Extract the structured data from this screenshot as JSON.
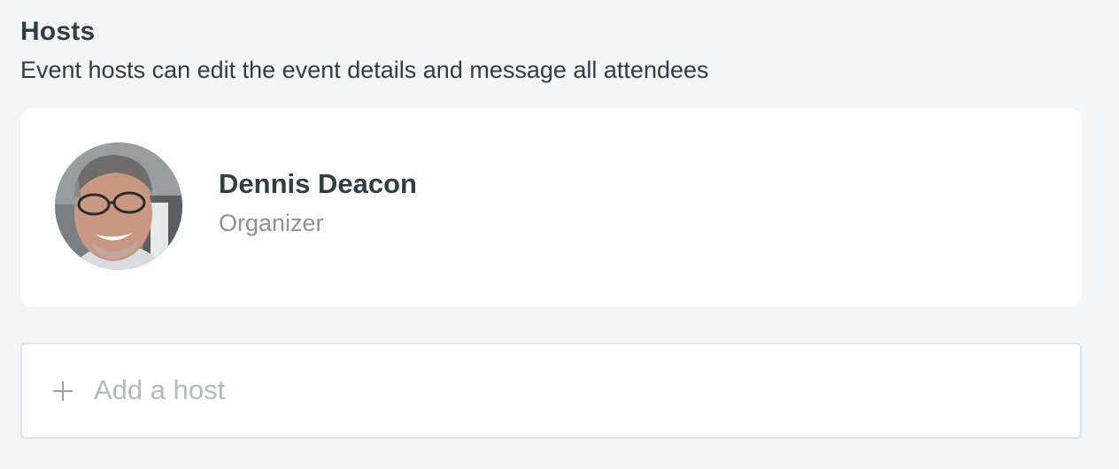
{
  "section": {
    "title": "Hosts",
    "description": "Event hosts can edit the event details and message all attendees"
  },
  "hosts": [
    {
      "name": "Dennis Deacon",
      "role": "Organizer",
      "avatar": "avatar-photo"
    }
  ],
  "add_host": {
    "label": "Add a host",
    "icon": "plus-icon"
  }
}
